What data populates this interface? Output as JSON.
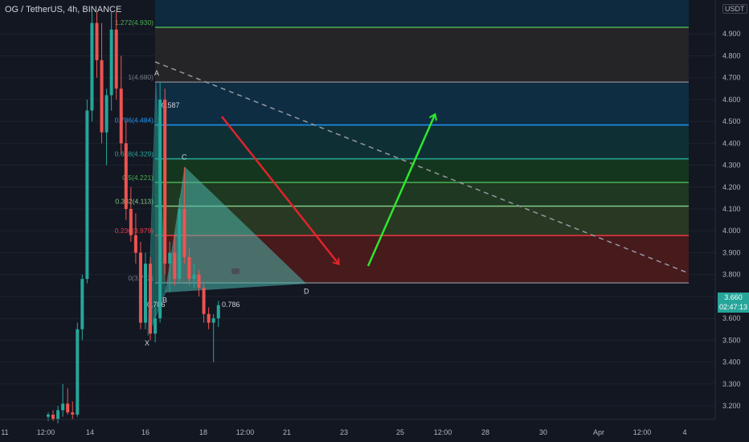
{
  "header": {
    "title": "OG / TetherUS, 4h, BINANCE",
    "currency_badge": "USDT"
  },
  "price_tag": {
    "price": "3.660",
    "countdown": "02:47:13"
  },
  "chart_data": {
    "type": "candlestick",
    "ylim": [
      3.14,
      5.05
    ],
    "price_ticks": [
      "3.200",
      "3.300",
      "3.400",
      "3.500",
      "3.600",
      "3.700",
      "3.800",
      "3.900",
      "4.000",
      "4.100",
      "4.200",
      "4.300",
      "4.400",
      "4.500",
      "4.600",
      "4.700",
      "4.800",
      "4.900"
    ],
    "time_ticks": [
      "11",
      "12:00",
      "14",
      "16",
      "18",
      "12:00",
      "21",
      "23",
      "25",
      "12:00",
      "28",
      "30",
      "Apr",
      "12:00",
      "4"
    ],
    "fib_levels": [
      {
        "label": "1.272(4.930)",
        "ratio": 1.272,
        "price": 4.93,
        "color": "#4caf50"
      },
      {
        "label": "1(4.680)",
        "ratio": 1,
        "price": 4.68,
        "color": "#787b86"
      },
      {
        "label": "0.786(4.484)",
        "ratio": 0.786,
        "price": 4.484,
        "color": "#2196f3"
      },
      {
        "label": "0.618(4.329)",
        "ratio": 0.618,
        "price": 4.329,
        "color": "#26a69a"
      },
      {
        "label": "0.5(4.221)",
        "ratio": 0.5,
        "price": 4.221,
        "color": "#4caf50"
      },
      {
        "label": "0.382(4.113)",
        "ratio": 0.382,
        "price": 4.113,
        "color": "#81c784"
      },
      {
        "label": "0.236(3.979)",
        "ratio": 0.236,
        "price": 3.979,
        "color": "#f23645"
      },
      {
        "label": "0(3.762)",
        "ratio": 0,
        "price": 3.762,
        "color": "#787b86"
      }
    ],
    "pattern_points": [
      {
        "label": "X",
        "price": 3.52
      },
      {
        "label": "A",
        "price": 4.68
      },
      {
        "label": "B",
        "price": 3.72
      },
      {
        "label": "C",
        "price": 4.29
      },
      {
        "label": "D",
        "price": 3.76
      }
    ],
    "pattern_ratios": [
      "0.587",
      "0.786",
      "0.786"
    ],
    "candles": [
      {
        "o": 3.15,
        "h": 3.17,
        "l": 3.13,
        "c": 3.16
      },
      {
        "o": 3.16,
        "h": 3.18,
        "l": 3.13,
        "c": 3.14
      },
      {
        "o": 3.14,
        "h": 3.2,
        "l": 3.12,
        "c": 3.18
      },
      {
        "o": 3.18,
        "h": 3.3,
        "l": 3.15,
        "c": 3.21
      },
      {
        "o": 3.21,
        "h": 3.28,
        "l": 3.16,
        "c": 3.17
      },
      {
        "o": 3.17,
        "h": 3.22,
        "l": 3.14,
        "c": 3.16
      },
      {
        "o": 3.16,
        "h": 3.58,
        "l": 3.15,
        "c": 3.55
      },
      {
        "o": 3.55,
        "h": 3.8,
        "l": 3.5,
        "c": 3.78
      },
      {
        "o": 3.78,
        "h": 4.6,
        "l": 3.76,
        "c": 4.55
      },
      {
        "o": 4.55,
        "h": 5.0,
        "l": 4.5,
        "c": 4.95
      },
      {
        "o": 4.95,
        "h": 5.0,
        "l": 4.7,
        "c": 4.78
      },
      {
        "o": 4.78,
        "h": 4.95,
        "l": 4.4,
        "c": 4.45
      },
      {
        "o": 4.45,
        "h": 4.65,
        "l": 4.3,
        "c": 4.62
      },
      {
        "o": 4.62,
        "h": 5.0,
        "l": 4.55,
        "c": 4.92
      },
      {
        "o": 4.92,
        "h": 5.0,
        "l": 4.6,
        "c": 4.65
      },
      {
        "o": 4.65,
        "h": 4.8,
        "l": 4.35,
        "c": 4.4
      },
      {
        "o": 4.4,
        "h": 4.5,
        "l": 4.05,
        "c": 4.1
      },
      {
        "o": 4.1,
        "h": 4.2,
        "l": 3.95,
        "c": 3.98
      },
      {
        "o": 3.98,
        "h": 4.08,
        "l": 3.85,
        "c": 3.9
      },
      {
        "o": 3.9,
        "h": 3.95,
        "l": 3.55,
        "c": 3.58
      },
      {
        "o": 3.58,
        "h": 3.9,
        "l": 3.55,
        "c": 3.85
      },
      {
        "o": 3.85,
        "h": 3.88,
        "l": 3.5,
        "c": 3.53
      },
      {
        "o": 3.53,
        "h": 3.65,
        "l": 3.49,
        "c": 3.6
      },
      {
        "o": 3.6,
        "h": 4.68,
        "l": 3.58,
        "c": 4.6
      },
      {
        "o": 4.6,
        "h": 4.65,
        "l": 3.8,
        "c": 3.85
      },
      {
        "o": 3.85,
        "h": 3.95,
        "l": 3.72,
        "c": 3.9
      },
      {
        "o": 3.9,
        "h": 3.98,
        "l": 3.75,
        "c": 3.78
      },
      {
        "o": 3.78,
        "h": 4.15,
        "l": 3.76,
        "c": 4.1
      },
      {
        "o": 4.1,
        "h": 4.29,
        "l": 3.85,
        "c": 3.88
      },
      {
        "o": 3.88,
        "h": 3.92,
        "l": 3.75,
        "c": 3.78
      },
      {
        "o": 3.78,
        "h": 3.85,
        "l": 3.74,
        "c": 3.8
      },
      {
        "o": 3.8,
        "h": 3.82,
        "l": 3.7,
        "c": 3.74
      },
      {
        "o": 3.74,
        "h": 3.76,
        "l": 3.58,
        "c": 3.62
      },
      {
        "o": 3.62,
        "h": 3.65,
        "l": 3.55,
        "c": 3.58
      },
      {
        "o": 3.58,
        "h": 3.62,
        "l": 3.4,
        "c": 3.6
      },
      {
        "o": 3.6,
        "h": 3.68,
        "l": 3.56,
        "c": 3.66
      }
    ]
  }
}
